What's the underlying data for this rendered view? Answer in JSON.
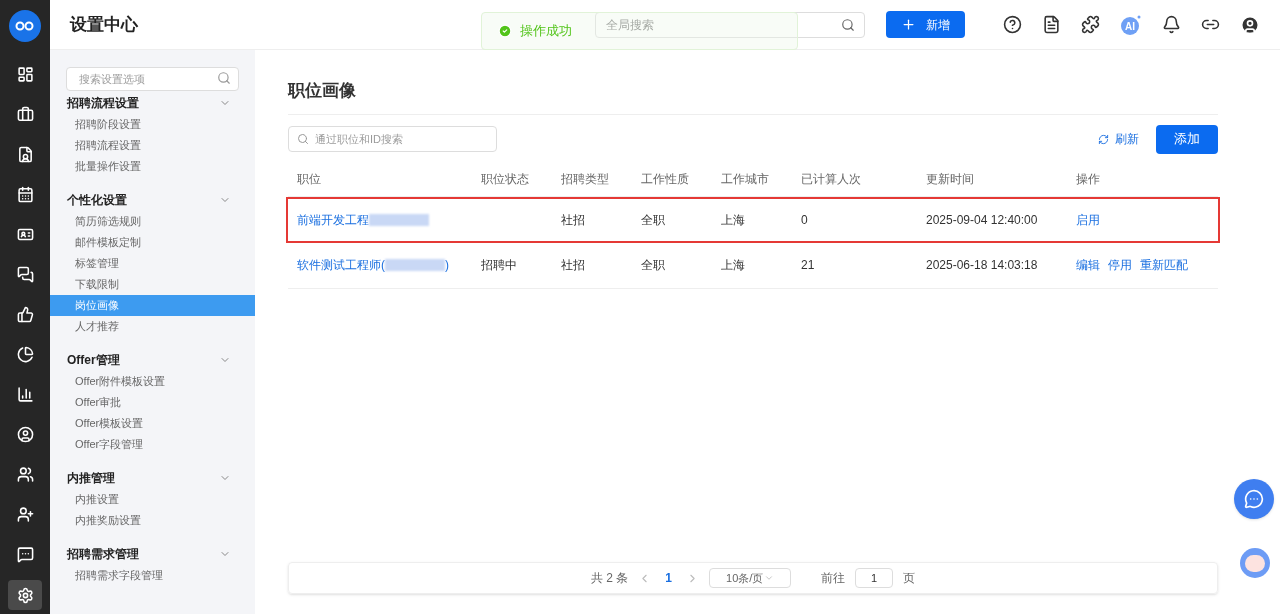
{
  "header": {
    "title": "设置中心",
    "search": {
      "placeholder": "全局搜索"
    },
    "new_button": "新增",
    "ai_label": "AI",
    "toast": {
      "text": "操作成功"
    }
  },
  "rail": [
    {
      "selected": false
    },
    {
      "selected": false
    },
    {
      "selected": false
    },
    {
      "selected": false
    },
    {
      "selected": false
    },
    {
      "selected": false
    },
    {
      "selected": false
    },
    {
      "selected": false
    },
    {
      "selected": false
    },
    {
      "selected": false
    },
    {
      "selected": false
    },
    {
      "selected": false
    },
    {
      "selected": false
    },
    {
      "selected": true
    }
  ],
  "sidebar": {
    "search": {
      "placeholder": "搜索设置选项"
    },
    "groups": [
      {
        "title": "招聘流程设置",
        "expanded": true,
        "items": [
          {
            "label": "招聘阶段设置",
            "selected": false
          },
          {
            "label": "招聘流程设置",
            "selected": false
          },
          {
            "label": "批量操作设置",
            "selected": false
          }
        ]
      },
      {
        "title": "个性化设置",
        "expanded": true,
        "items": [
          {
            "label": "简历筛选规则",
            "selected": false
          },
          {
            "label": "邮件模板定制",
            "selected": false
          },
          {
            "label": "标签管理",
            "selected": false
          },
          {
            "label": "下载限制",
            "selected": false
          },
          {
            "label": "岗位画像",
            "selected": true
          },
          {
            "label": "人才推荐",
            "selected": false
          }
        ]
      },
      {
        "title": "Offer管理",
        "expanded": true,
        "items": [
          {
            "label": "Offer附件模板设置",
            "selected": false
          },
          {
            "label": "Offer审批",
            "selected": false
          },
          {
            "label": "Offer模板设置",
            "selected": false
          },
          {
            "label": "Offer字段管理",
            "selected": false
          }
        ]
      },
      {
        "title": "内推管理",
        "expanded": true,
        "items": [
          {
            "label": "内推设置",
            "selected": false
          },
          {
            "label": "内推奖励设置",
            "selected": false
          }
        ]
      },
      {
        "title": "招聘需求管理",
        "expanded": true,
        "items": [
          {
            "label": "招聘需求字段管理",
            "selected": false
          }
        ]
      }
    ]
  },
  "page": {
    "title": "职位画像",
    "search": {
      "placeholder": "通过职位和ID搜索"
    },
    "refresh": "刷新",
    "add": "添加"
  },
  "table": {
    "columns": [
      "职位",
      "职位状态",
      "招聘类型",
      "工作性质",
      "工作城市",
      "已计算人次",
      "更新时间",
      "操作"
    ],
    "rows": [
      {
        "highlighted": true,
        "name": "前端开发工程",
        "blurred": true,
        "type": "社招",
        "nature": "全职",
        "city": "上海",
        "count": "0",
        "updated": "2025-09-04 12:40:00",
        "actions": [
          "启用"
        ]
      },
      {
        "highlighted": false,
        "name": "软件测试工程师(",
        "blurred": true,
        "name_suffix": ")",
        "status": "招聘中",
        "type": "社招",
        "nature": "全职",
        "city": "上海",
        "count": "21",
        "updated": "2025-06-18 14:03:18",
        "actions": [
          "编辑",
          "停用",
          "重新匹配"
        ]
      }
    ]
  },
  "pagination": {
    "total": "共 2 条",
    "pages": [
      {
        "label": "1",
        "selected": true
      }
    ],
    "page_size": "10条/页",
    "goto_label": "前往",
    "goto_value": "1",
    "goto_suffix": "页"
  }
}
